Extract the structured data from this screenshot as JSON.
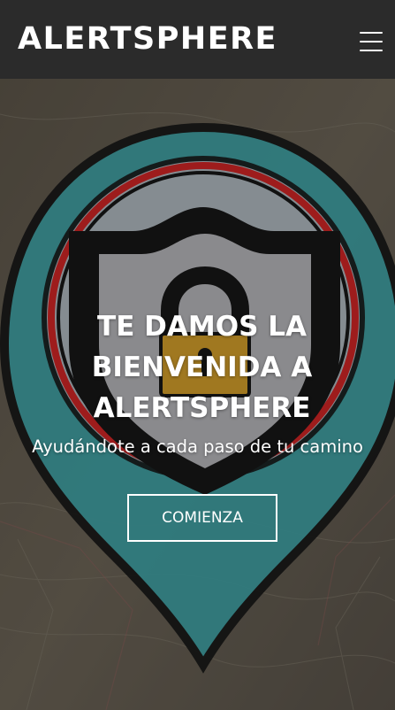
{
  "navbar": {
    "brand": "ALERTSPHERE",
    "menu_icon": "hamburger-menu-icon"
  },
  "hero": {
    "title": "TE DAMOS LA BIENVENIDA A ALERTSPHERE",
    "subtitle": "Ayudándote a cada paso de tu camino",
    "cta_label": "COMIENZA",
    "graphic_icon": "map-pin-shield-lock-icon",
    "background": "map-background"
  },
  "colors": {
    "navbar_bg": "#2b2b2b",
    "pin_teal": "#2f7d80",
    "ring_red": "#9e1c1c",
    "shield_gray": "#8a8a8d",
    "lock_gold": "#a07820",
    "text": "#ffffff"
  }
}
